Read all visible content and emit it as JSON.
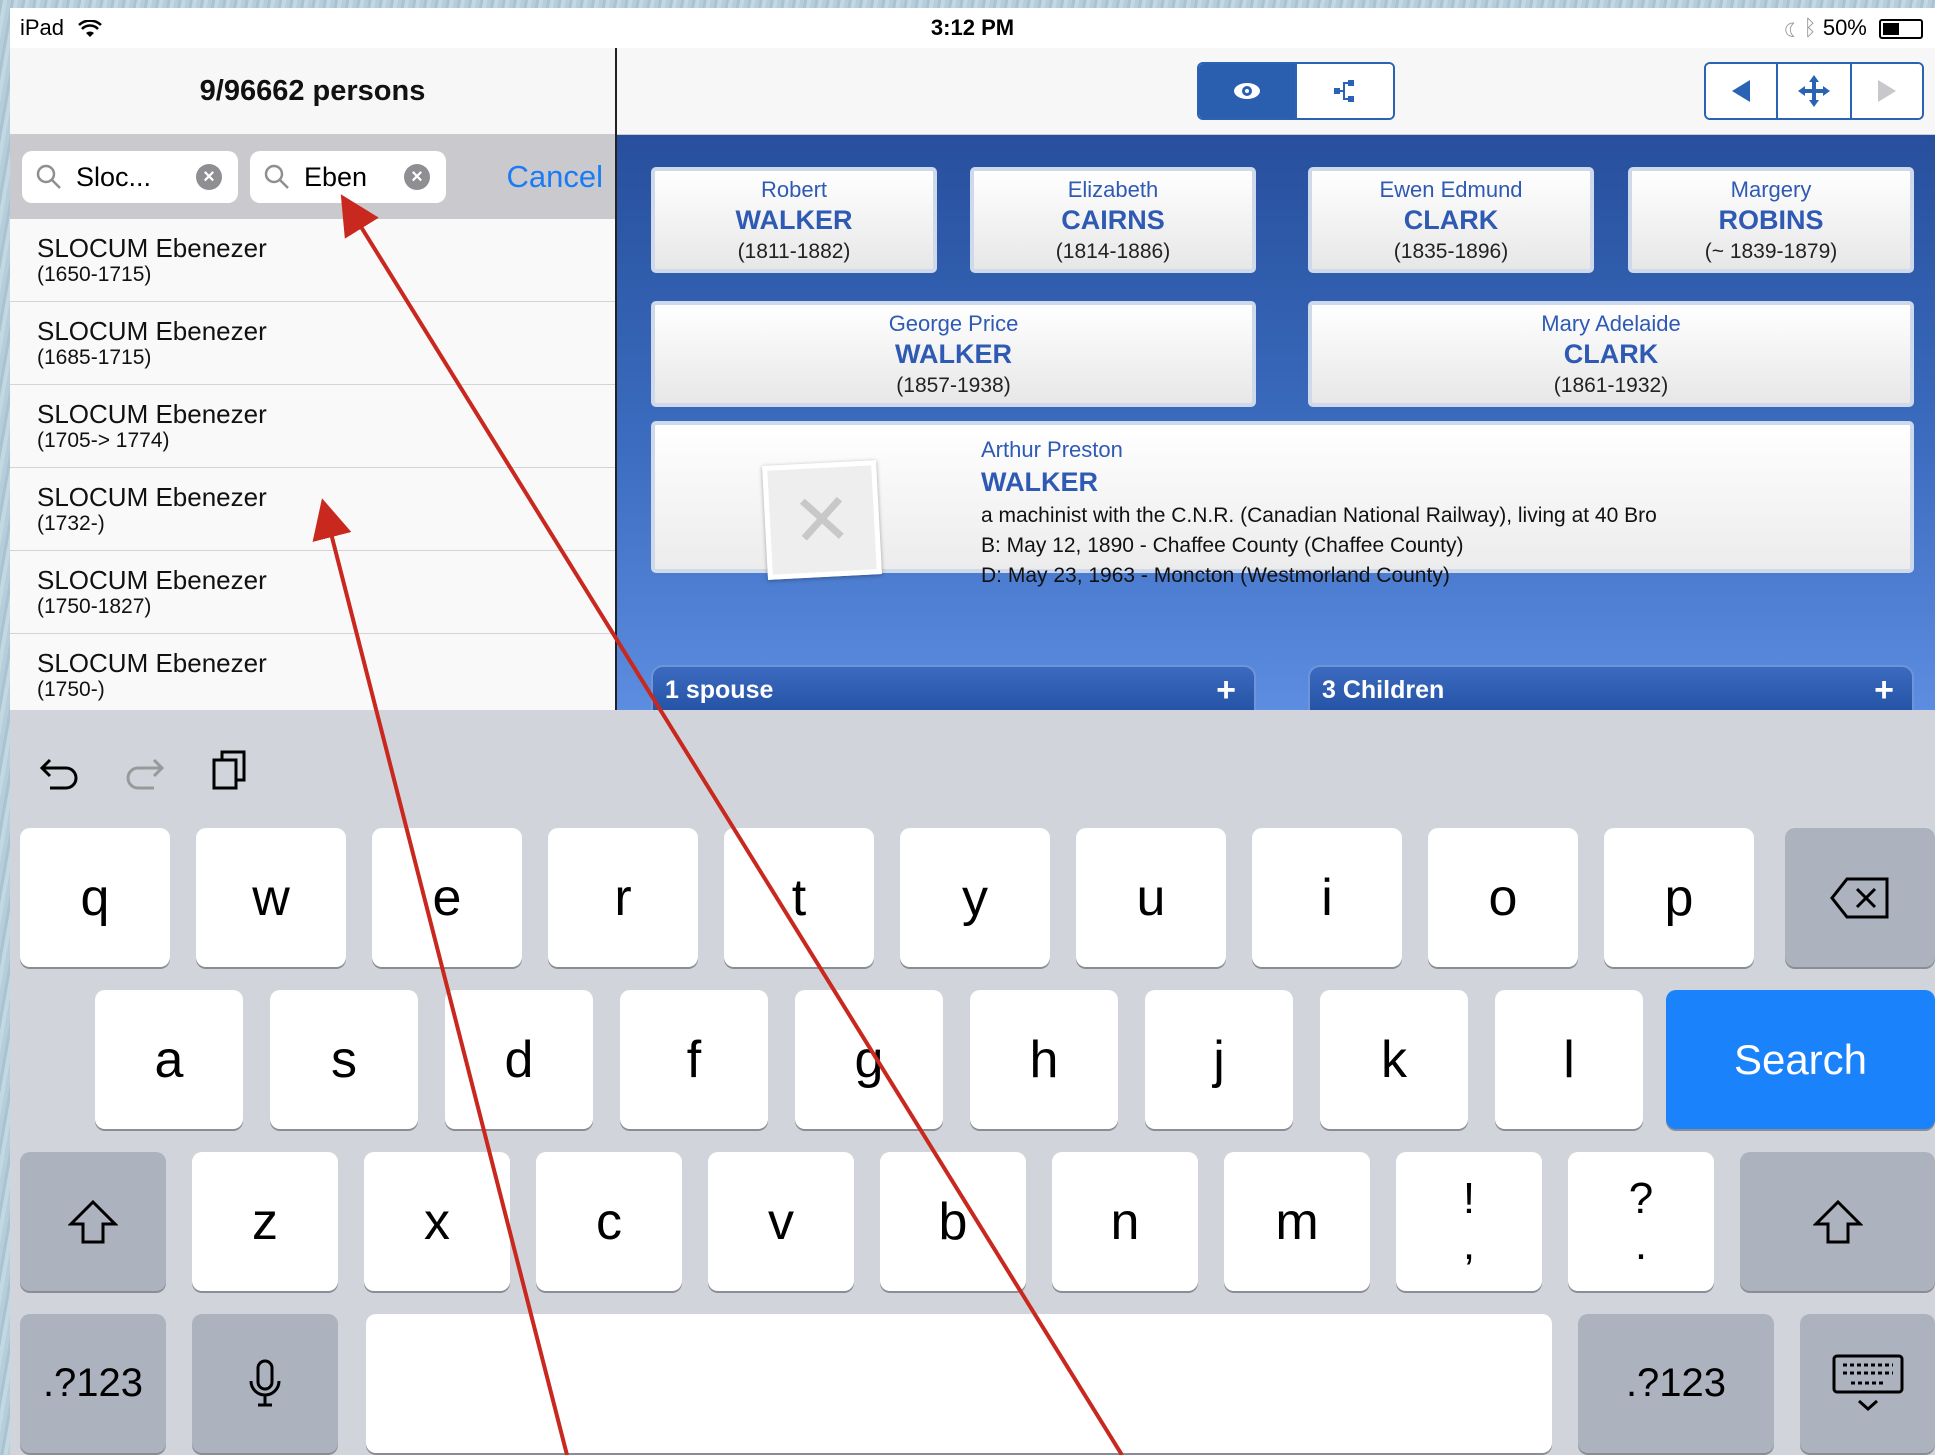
{
  "status_bar": {
    "device": "iPad",
    "time": "3:12 PM",
    "battery": "50%",
    "battery_level": 0.5
  },
  "left_panel": {
    "title": "9/96662 persons",
    "search_fields": [
      {
        "value": "Sloc..."
      },
      {
        "value": "Eben"
      }
    ],
    "cancel_label": "Cancel",
    "results": [
      {
        "name": "SLOCUM Ebenezer",
        "dates": "(1650-1715)"
      },
      {
        "name": "SLOCUM Ebenezer",
        "dates": "(1685-1715)"
      },
      {
        "name": "SLOCUM Ebenezer",
        "dates": "(1705-> 1774)"
      },
      {
        "name": "SLOCUM Ebenezer",
        "dates": "(1732-)"
      },
      {
        "name": "SLOCUM Ebenezer",
        "dates": "(1750-1827)"
      },
      {
        "name": "SLOCUM Ebenezer",
        "dates": "(1750-)"
      }
    ]
  },
  "tree": {
    "grandparents": [
      {
        "given": "Robert",
        "surname": "WALKER",
        "dates": "(1811-1882)"
      },
      {
        "given": "Elizabeth",
        "surname": "CAIRNS",
        "dates": "(1814-1886)"
      },
      {
        "given": "Ewen Edmund",
        "surname": "CLARK",
        "dates": "(1835-1896)"
      },
      {
        "given": "Margery",
        "surname": "ROBINS",
        "dates": "(~ 1839-1879)"
      }
    ],
    "parents": [
      {
        "given": "George Price",
        "surname": "WALKER",
        "dates": "(1857-1938)"
      },
      {
        "given": "Mary Adelaide",
        "surname": "CLARK",
        "dates": "(1861-1932)"
      }
    ],
    "person": {
      "given": "Arthur Preston",
      "surname": "WALKER",
      "note": "a machinist with the C.N.R. (Canadian National Railway), living at 40 Bro",
      "birth": "B: May 12, 1890 - Chaffee County (Chaffee County)",
      "death": "D: May 23, 1963 - Moncton (Westmorland County)"
    },
    "spouse_bar": "1 spouse",
    "children_bar": "3 Children",
    "plus": "+"
  },
  "keyboard": {
    "row1": [
      "q",
      "w",
      "e",
      "r",
      "t",
      "y",
      "u",
      "i",
      "o",
      "p"
    ],
    "row2": [
      "a",
      "s",
      "d",
      "f",
      "g",
      "h",
      "j",
      "k",
      "l"
    ],
    "row3": [
      "z",
      "x",
      "c",
      "v",
      "b",
      "n",
      "m"
    ],
    "punct1": {
      "top": "!",
      "bottom": ","
    },
    "punct2": {
      "top": "?",
      "bottom": "."
    },
    "search_label": "Search",
    "numbers_label": ".?123"
  },
  "colors": {
    "accent": "#1a82fb",
    "tree_dark": "#274f9d",
    "annotation": "#c8281e"
  }
}
